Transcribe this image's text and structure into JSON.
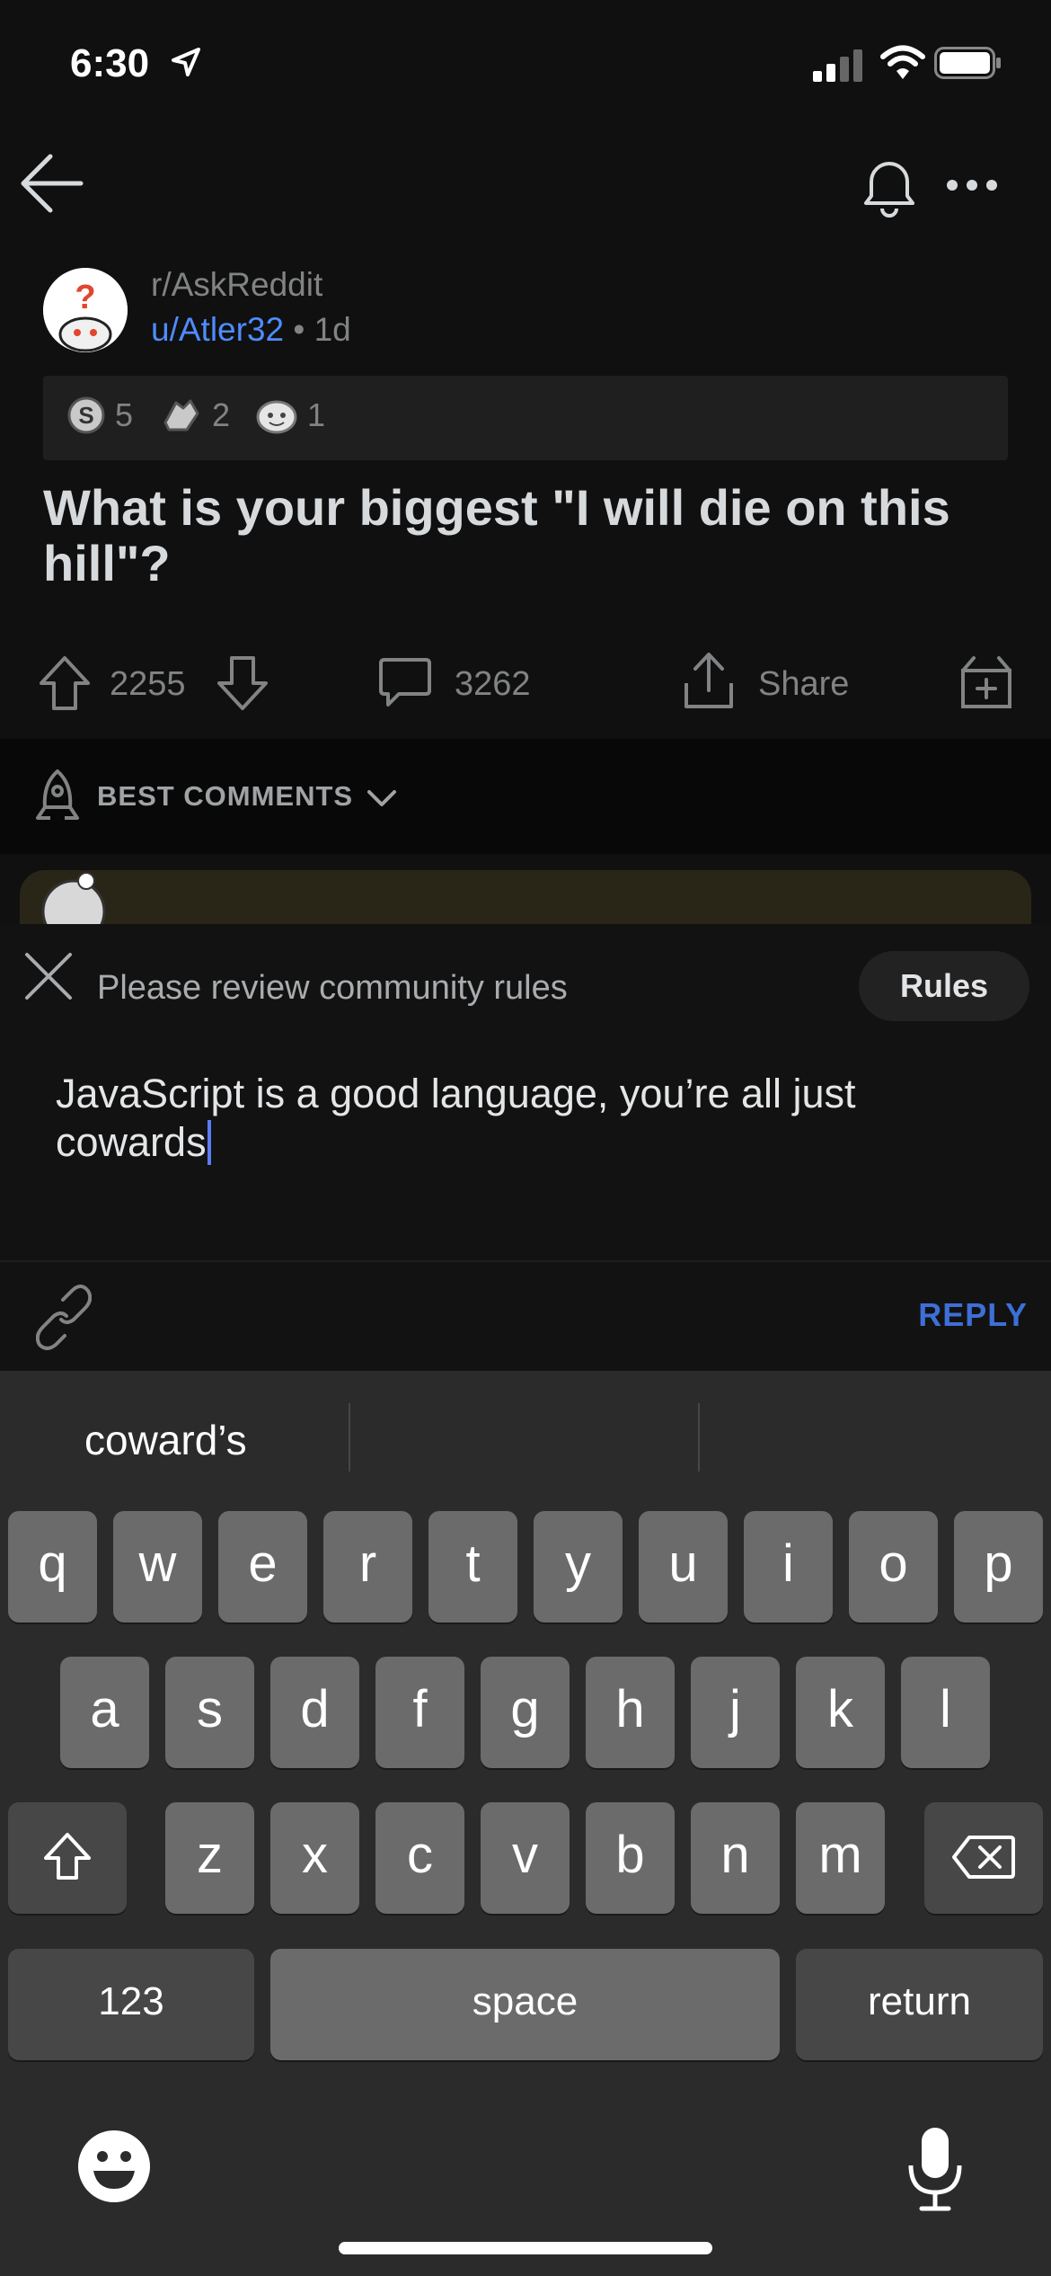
{
  "status_bar": {
    "time": "6:30"
  },
  "post": {
    "subreddit": "r/AskReddit",
    "user": "u/Atler32",
    "age": "• 1d",
    "awards": [
      {
        "icon": "silver-award-icon",
        "count": "5"
      },
      {
        "icon": "helpful-award-icon",
        "count": "2"
      },
      {
        "icon": "wholesome-award-icon",
        "count": "1"
      }
    ],
    "title": "What is your biggest \"I will die on this hill\"?",
    "votes": "2255",
    "comments": "3262",
    "share_label": "Share"
  },
  "sort": {
    "label": "BEST COMMENTS"
  },
  "composer": {
    "rules_text": "Please review community rules",
    "rules_button": "Rules",
    "text": "JavaScript is a good language, you’re all just cowards",
    "reply_label": "REPLY"
  },
  "keyboard": {
    "suggestions": [
      "coward’s",
      "",
      ""
    ],
    "row1": [
      "q",
      "w",
      "e",
      "r",
      "t",
      "y",
      "u",
      "i",
      "o",
      "p"
    ],
    "row2": [
      "a",
      "s",
      "d",
      "f",
      "g",
      "h",
      "j",
      "k",
      "l"
    ],
    "row3": [
      "z",
      "x",
      "c",
      "v",
      "b",
      "n",
      "m"
    ],
    "numbers_label": "123",
    "space_label": "space",
    "return_label": "return"
  }
}
